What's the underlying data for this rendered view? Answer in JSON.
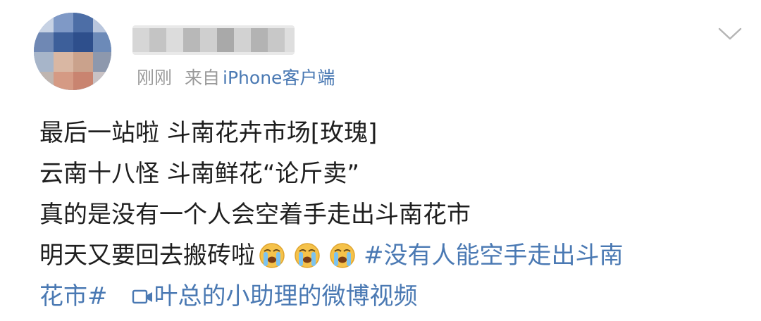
{
  "post": {
    "username_blurred": true,
    "time": "刚刚",
    "from_label": "来自",
    "source": "iPhone客户端",
    "menu_icon": "chevron-down-icon",
    "lines": {
      "l1": "最后一站啦 斗南花卉市场[玫瑰]",
      "l2": "云南十八怪 斗南鲜花“论斤卖”",
      "l3": "真的是没有一个人会空着手走出斗南花市",
      "l4_text": "明天又要回去搬砖啦",
      "l4_hashtag": "#没有人能空手走出斗南",
      "l5_hashtag": "花市#",
      "video_link": "叶总的小助理的微博视频"
    },
    "emojis": [
      "crying-face-emoji",
      "crying-face-emoji",
      "crying-face-emoji"
    ],
    "colors": {
      "link": "#4a79b3",
      "meta_gray": "#9a9a9a",
      "text": "#1e1e1e"
    }
  }
}
